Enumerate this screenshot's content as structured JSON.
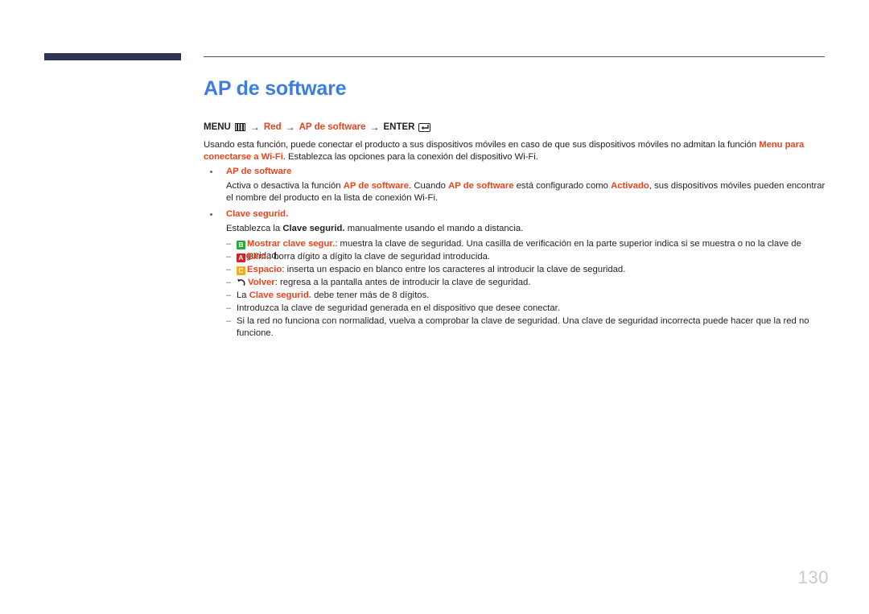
{
  "header": {
    "bar_color": "#2e3552",
    "rule_color": "#4a4f6b"
  },
  "title": "AP de software",
  "menu_path": {
    "menu_label": "MENU",
    "menu_icon": "menu-grid-icon",
    "arrow": "→",
    "step1": "Red",
    "step2": "AP de software",
    "enter_label": "ENTER",
    "enter_icon": "enter-key-icon",
    "accent_color": "#e8431c"
  },
  "intro": {
    "line1_a": "Usando esta función, puede conectar el producto a sus dispositivos móviles en caso de que sus dispositivos móviles no admitan la función ",
    "line1_b": "Menu para conectarse a Wi-Fi",
    "line1_c": ". Establezca las opciones para la conexión del dispositivo Wi-Fi."
  },
  "sections": [
    {
      "label": "AP de software",
      "body_a": "Activa o desactiva la función ",
      "body_b": "AP de software",
      "body_c": ". Cuando ",
      "body_d": "AP de software",
      "body_e": " está configurado como ",
      "body_f": "Activado",
      "body_g": ", sus dispositivos móviles pueden encontrar el nombre del producto en la lista de conexión Wi-Fi."
    },
    {
      "label": "Clave segurid.",
      "body_a": "Establezca la ",
      "body_b": "Clave segurid.",
      "body_c": " manualmente usando el mando a distancia."
    }
  ],
  "dash_items": [
    {
      "badge": "B",
      "badge_name": "b-key-badge",
      "badge_color": "#2aa939",
      "bold": "Mostrar clave segur.",
      "rest": ": muestra la clave de seguridad. Una casilla de verificación en la parte superior indica si se muestra o no la clave de seguridad."
    },
    {
      "badge": "A",
      "badge_name": "a-key-badge",
      "badge_color": "#d61f26",
      "bold": "Elim.",
      "rest": ": borra dígito a dígito la clave de seguridad introducida."
    },
    {
      "badge": "C",
      "badge_name": "c-key-badge",
      "badge_color": "#f2ab1e",
      "bold": "Espacio",
      "rest": ": inserta un espacio en blanco entre los caracteres al introducir la clave de seguridad."
    },
    {
      "badge": "",
      "badge_name": "return-arrow-icon",
      "badge_color": "",
      "bold": "Volver",
      "rest": ": regresa a la pantalla antes de introducir la clave de seguridad."
    },
    {
      "badge": null,
      "badge_name": null,
      "badge_color": "",
      "pre": "La ",
      "bold": "Clave segurid.",
      "rest": " debe tener más de 8 dígitos."
    },
    {
      "badge": null,
      "badge_name": null,
      "badge_color": "",
      "plain": "Introduzca la clave de seguridad generada en el dispositivo que desee conectar."
    },
    {
      "badge": null,
      "badge_name": null,
      "badge_color": "",
      "plain": "Si la red no funciona con normalidad, vuelva a comprobar la clave de seguridad. Una clave de seguridad incorrecta puede hacer que la red no funcione."
    }
  ],
  "dash_mark": "–",
  "bullet_mark": "•",
  "page_number": "130"
}
